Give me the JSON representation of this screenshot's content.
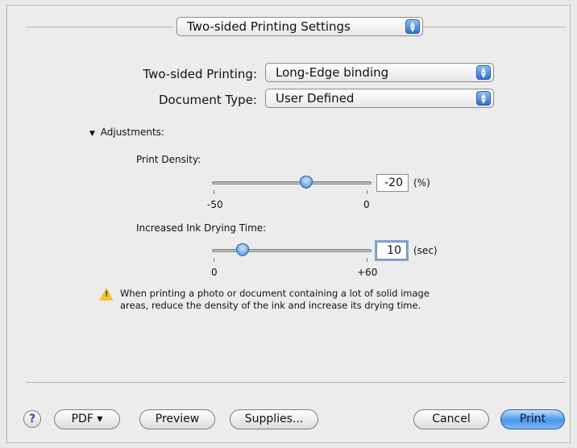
{
  "panel_selector": {
    "value": "Two-sided Printing Settings"
  },
  "two_sided": {
    "label": "Two-sided Printing:",
    "value": "Long-Edge binding"
  },
  "document_type": {
    "label": "Document Type:",
    "value": "User Defined"
  },
  "adjustments": {
    "toggle": "▼",
    "label": "Adjustments:",
    "print_density": {
      "label": "Print Density:",
      "min_label": "-50",
      "max_label": "0",
      "min": -50,
      "max": 0,
      "value": -20,
      "field_value": "-20",
      "unit": "(%)"
    },
    "drying_time": {
      "label": "Increased Ink Drying Time:",
      "min_label": "0",
      "max_label": "+60",
      "min": 0,
      "max": 60,
      "value": 10,
      "field_value": "10",
      "unit": "(sec)"
    }
  },
  "warning": {
    "icon": "warning-icon",
    "line1": "When printing a photo or document containing a lot of solid image",
    "line2": "areas, reduce the density of the ink and increase its drying time."
  },
  "footer": {
    "help_label": "?",
    "pdf_label": "PDF ▾",
    "preview_label": "Preview",
    "supplies_label": "Supplies...",
    "cancel_label": "Cancel",
    "print_label": "Print"
  },
  "colors": {
    "accent": "#3b82dc",
    "warning": "#f4c531"
  }
}
